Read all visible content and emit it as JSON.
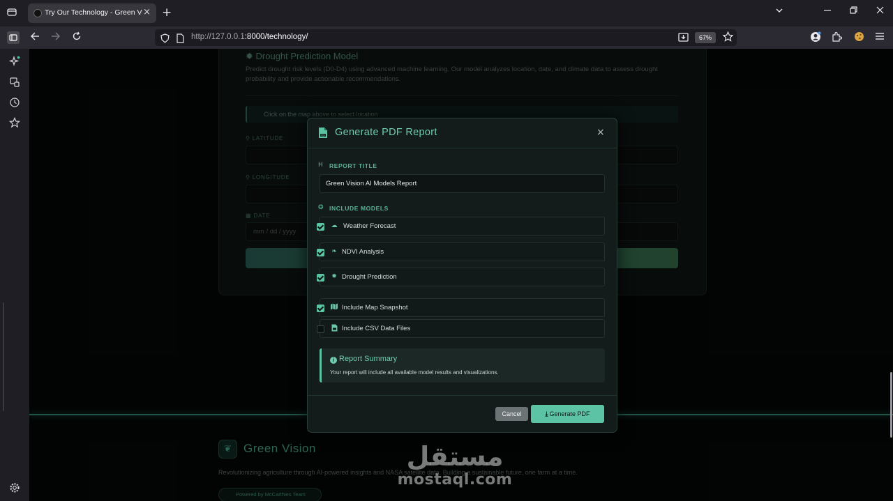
{
  "browser": {
    "tab_title": "Try Our Technology - Green Visi",
    "tab_close": "×",
    "new_tab": "+",
    "url_host": "http://127.0.0.1",
    "url_path": ":8000/technology/",
    "zoom": "67%"
  },
  "page": {
    "card_title": "Drought Prediction Model",
    "card_description": "Predict drought risk levels (D0-D4) using advanced machine learning. Our model analyzes location, date, and climate data to assess drought probability and provide actionable recommendations.",
    "map_hint": "Click on the map above to select location",
    "latitude_label": "LATITUDE",
    "longitude_label": "LONGITUDE",
    "date_label": "DATE",
    "date_placeholder": "mm / dd / yyyy",
    "footer_brand": "Green Vision",
    "footer_description": "Revolutionizing agriculture through AI-powered insights and NASA satellite data. Building a sustainable future, one farm at a time.",
    "footer_badge": "Powered by McCarthies Team"
  },
  "watermark": {
    "arabic": "مستقل",
    "latin": "mostaql.com"
  },
  "modal": {
    "title": "Generate PDF Report",
    "close": "×",
    "report_title_label": "REPORT TITLE",
    "report_title_value": "Green Vision AI Models Report",
    "include_models_label": "INCLUDE MODELS",
    "models": [
      {
        "label": "Weather Forecast",
        "checked": true,
        "icon": "cloud-sun-icon"
      },
      {
        "label": "NDVI Analysis",
        "checked": true,
        "icon": "leaf-icon"
      },
      {
        "label": "Drought Prediction",
        "checked": true,
        "icon": "sun-icon"
      }
    ],
    "extras": [
      {
        "label": "Include Map Snapshot",
        "checked": true,
        "icon": "map-icon"
      },
      {
        "label": "Include CSV Data Files",
        "checked": false,
        "icon": "csv-file-icon"
      }
    ],
    "summary_title": "Report Summary",
    "summary_text": "Your report will include all available model results and visualizations.",
    "cancel_label": "Cancel",
    "generate_label": "Generate PDF"
  }
}
